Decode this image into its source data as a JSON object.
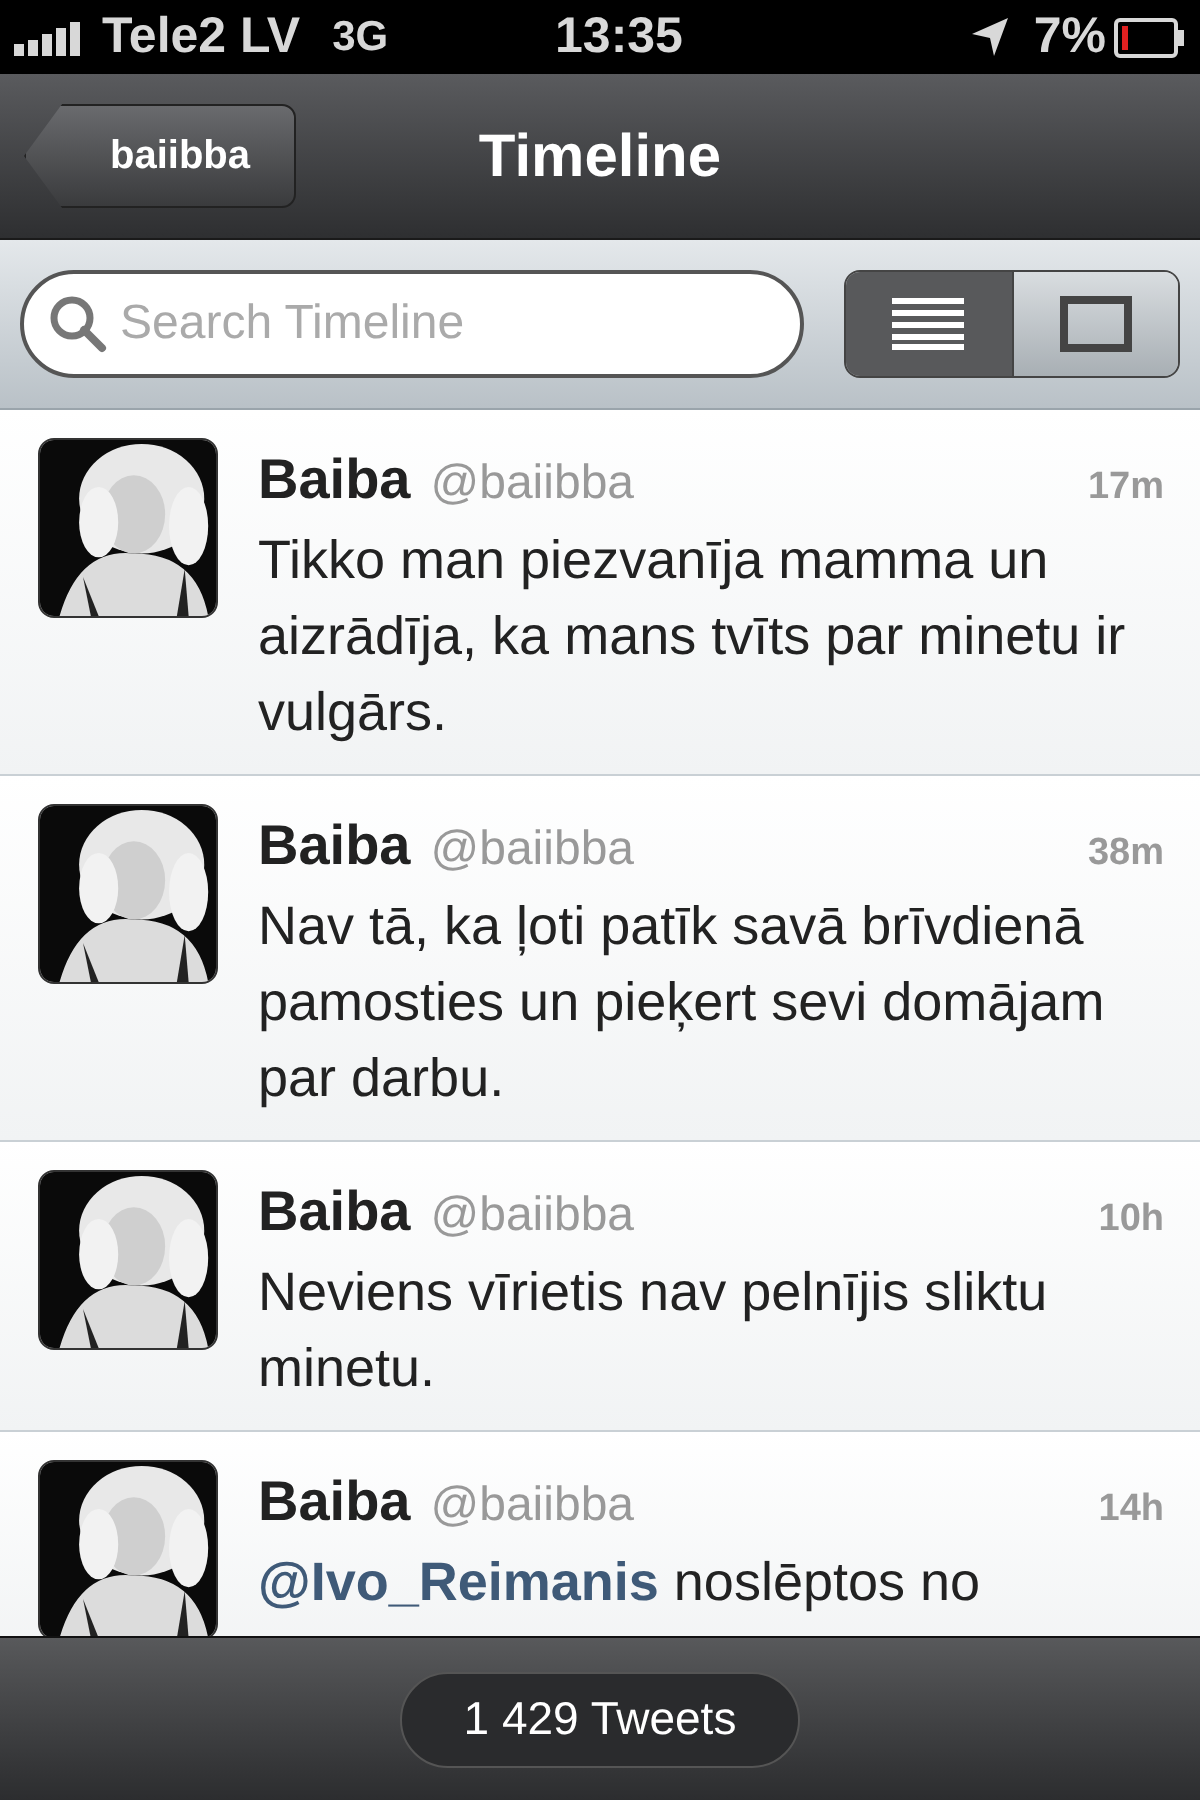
{
  "status_bar": {
    "carrier": "Tele2 LV",
    "network": "3G",
    "time": "13:35",
    "battery": "7%"
  },
  "nav_bar": {
    "back": "baiibba",
    "title": "Timeline"
  },
  "search": {
    "placeholder": "Search Timeline"
  },
  "view_toggle": [
    {
      "kind": "list",
      "selected": true
    },
    {
      "kind": "single",
      "selected": false
    }
  ],
  "tweets": [
    {
      "name": "Baiba",
      "handle": "@baiibba",
      "time": "17m",
      "text": "Tikko man piezvanīja mamma un aizrādīja, ka mans tvīts par minetu ir vulgārs."
    },
    {
      "name": "Baiba",
      "handle": "@baiibba",
      "time": "38m",
      "text": "Nav tā, ka ļoti patīk savā brīvdienā pamosties un pieķert sevi domājam par darbu."
    },
    {
      "name": "Baiba",
      "handle": "@baiibba",
      "time": "10h",
      "text": "Neviens vīrietis nav pelnījis sliktu minetu."
    },
    {
      "name": "Baiba",
      "handle": "@baiibba",
      "time": "14h",
      "text": "**@Ivo_Reimanis** noslēptos no"
    }
  ],
  "footer": {
    "count": "1 429 Tweets"
  }
}
